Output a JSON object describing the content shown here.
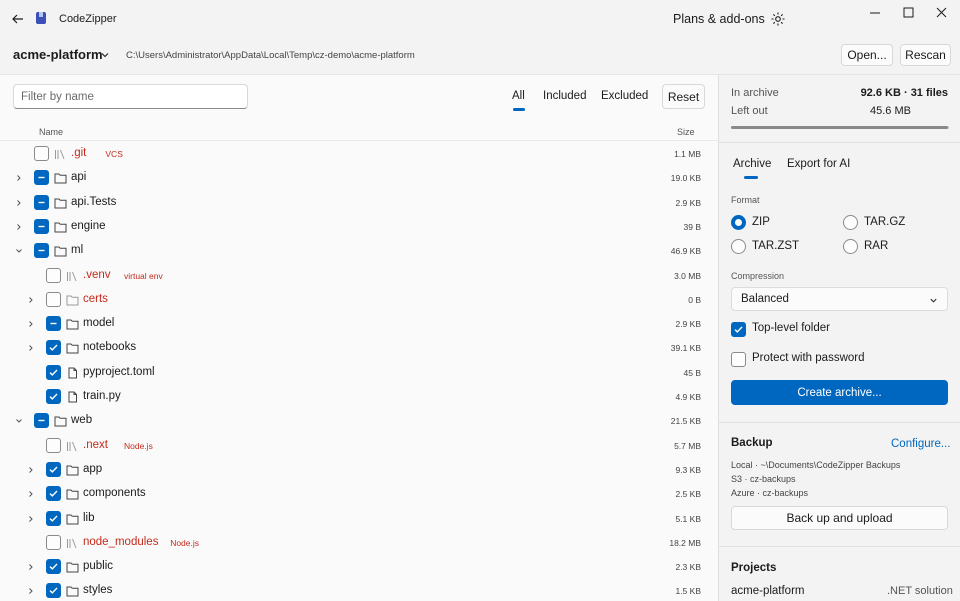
{
  "titlebar": {
    "app_title": "CodeZipper",
    "plans_label": "Plans & add-ons"
  },
  "pathbar": {
    "project_name": "acme-platform",
    "path": "C:\\Users\\Administrator\\AppData\\Local\\Temp\\cz-demo\\acme-platform",
    "open_label": "Open...",
    "rescan_label": "Rescan"
  },
  "filter": {
    "placeholder": "Filter by name",
    "segments": [
      "All",
      "Included",
      "Excluded"
    ],
    "selected_segment": "All",
    "reset_label": "Reset"
  },
  "columns": {
    "name": "Name",
    "size": "Size"
  },
  "tree": [
    {
      "name": ".git",
      "tag": "VCS",
      "size": "1.1 MB",
      "depth": 0,
      "expander": "none",
      "check": "unchecked",
      "icon": "stack-icon",
      "excluded": true
    },
    {
      "name": "api",
      "tag": "",
      "size": "19.0 KB",
      "depth": 0,
      "expander": "collapsed",
      "check": "partial",
      "icon": "folder-icon",
      "excluded": false
    },
    {
      "name": "api.Tests",
      "tag": "",
      "size": "2.9 KB",
      "depth": 0,
      "expander": "collapsed",
      "check": "partial",
      "icon": "folder-icon",
      "excluded": false
    },
    {
      "name": "engine",
      "tag": "",
      "size": "39 B",
      "depth": 0,
      "expander": "collapsed",
      "check": "partial",
      "icon": "folder-icon",
      "excluded": false
    },
    {
      "name": "ml",
      "tag": "",
      "size": "46.9 KB",
      "depth": 0,
      "expander": "expanded",
      "check": "partial",
      "icon": "folder-icon",
      "excluded": false
    },
    {
      "name": ".venv",
      "tag": "virtual env",
      "size": "3.0 MB",
      "depth": 1,
      "expander": "none",
      "check": "unchecked",
      "icon": "stack-icon",
      "excluded": true
    },
    {
      "name": "certs",
      "tag": "",
      "size": "0 B",
      "depth": 1,
      "expander": "collapsed",
      "check": "unchecked",
      "icon": "folder-icon",
      "excluded": true
    },
    {
      "name": "model",
      "tag": "",
      "size": "2.9 KB",
      "depth": 1,
      "expander": "collapsed",
      "check": "partial",
      "icon": "folder-icon",
      "excluded": false
    },
    {
      "name": "notebooks",
      "tag": "",
      "size": "39.1 KB",
      "depth": 1,
      "expander": "collapsed",
      "check": "checked",
      "icon": "folder-icon",
      "excluded": false
    },
    {
      "name": "pyproject.toml",
      "tag": "",
      "size": "45 B",
      "depth": 1,
      "expander": "none",
      "check": "checked",
      "icon": "file-icon",
      "excluded": false
    },
    {
      "name": "train.py",
      "tag": "",
      "size": "4.9 KB",
      "depth": 1,
      "expander": "none",
      "check": "checked",
      "icon": "file-icon",
      "excluded": false
    },
    {
      "name": "web",
      "tag": "",
      "size": "21.5 KB",
      "depth": 0,
      "expander": "expanded",
      "check": "partial",
      "icon": "folder-icon",
      "excluded": false
    },
    {
      "name": ".next",
      "tag": "Node.js",
      "size": "5.7 MB",
      "depth": 1,
      "expander": "none",
      "check": "unchecked",
      "icon": "stack-icon",
      "excluded": true
    },
    {
      "name": "app",
      "tag": "",
      "size": "9.3 KB",
      "depth": 1,
      "expander": "collapsed",
      "check": "checked",
      "icon": "folder-icon",
      "excluded": false
    },
    {
      "name": "components",
      "tag": "",
      "size": "2.5 KB",
      "depth": 1,
      "expander": "collapsed",
      "check": "checked",
      "icon": "folder-icon",
      "excluded": false
    },
    {
      "name": "lib",
      "tag": "",
      "size": "5.1 KB",
      "depth": 1,
      "expander": "collapsed",
      "check": "checked",
      "icon": "folder-icon",
      "excluded": false
    },
    {
      "name": "node_modules",
      "tag": "Node.js",
      "size": "18.2 MB",
      "depth": 1,
      "expander": "none",
      "check": "unchecked",
      "icon": "stack-icon",
      "excluded": true
    },
    {
      "name": "public",
      "tag": "",
      "size": "2.3 KB",
      "depth": 1,
      "expander": "collapsed",
      "check": "checked",
      "icon": "folder-icon",
      "excluded": false
    },
    {
      "name": "styles",
      "tag": "",
      "size": "1.5 KB",
      "depth": 1,
      "expander": "collapsed",
      "check": "checked",
      "icon": "folder-icon",
      "excluded": false
    }
  ],
  "summary": {
    "in_archive_label": "In archive",
    "in_archive_value": "92.6 KB · 31 files",
    "left_out_label": "Left out",
    "left_out_value": "45.6 MB",
    "progress_fraction": 0.997
  },
  "export": {
    "tabs": [
      "Archive",
      "Export for AI"
    ],
    "selected_tab": "Archive",
    "format_label": "Format",
    "formats": [
      "ZIP",
      "TAR.GZ",
      "TAR.ZST",
      "RAR"
    ],
    "selected_format": "ZIP",
    "compression_label": "Compression",
    "compression_value": "Balanced",
    "top_level_folder_label": "Top-level folder",
    "top_level_folder_checked": true,
    "protect_label": "Protect with password",
    "protect_checked": false,
    "create_label": "Create archive..."
  },
  "backup": {
    "title": "Backup",
    "configure_label": "Configure...",
    "targets": [
      "Local · ~\\Documents\\CodeZipper Backups",
      "S3 · cz-backups",
      "Azure · cz-backups"
    ],
    "button_label": "Back up and upload"
  },
  "projects": {
    "title": "Projects",
    "items": [
      {
        "name": "acme-platform",
        "type": ".NET solution"
      }
    ]
  },
  "colors": {
    "accent": "#0067c0",
    "excluded": "#c42b1c"
  }
}
